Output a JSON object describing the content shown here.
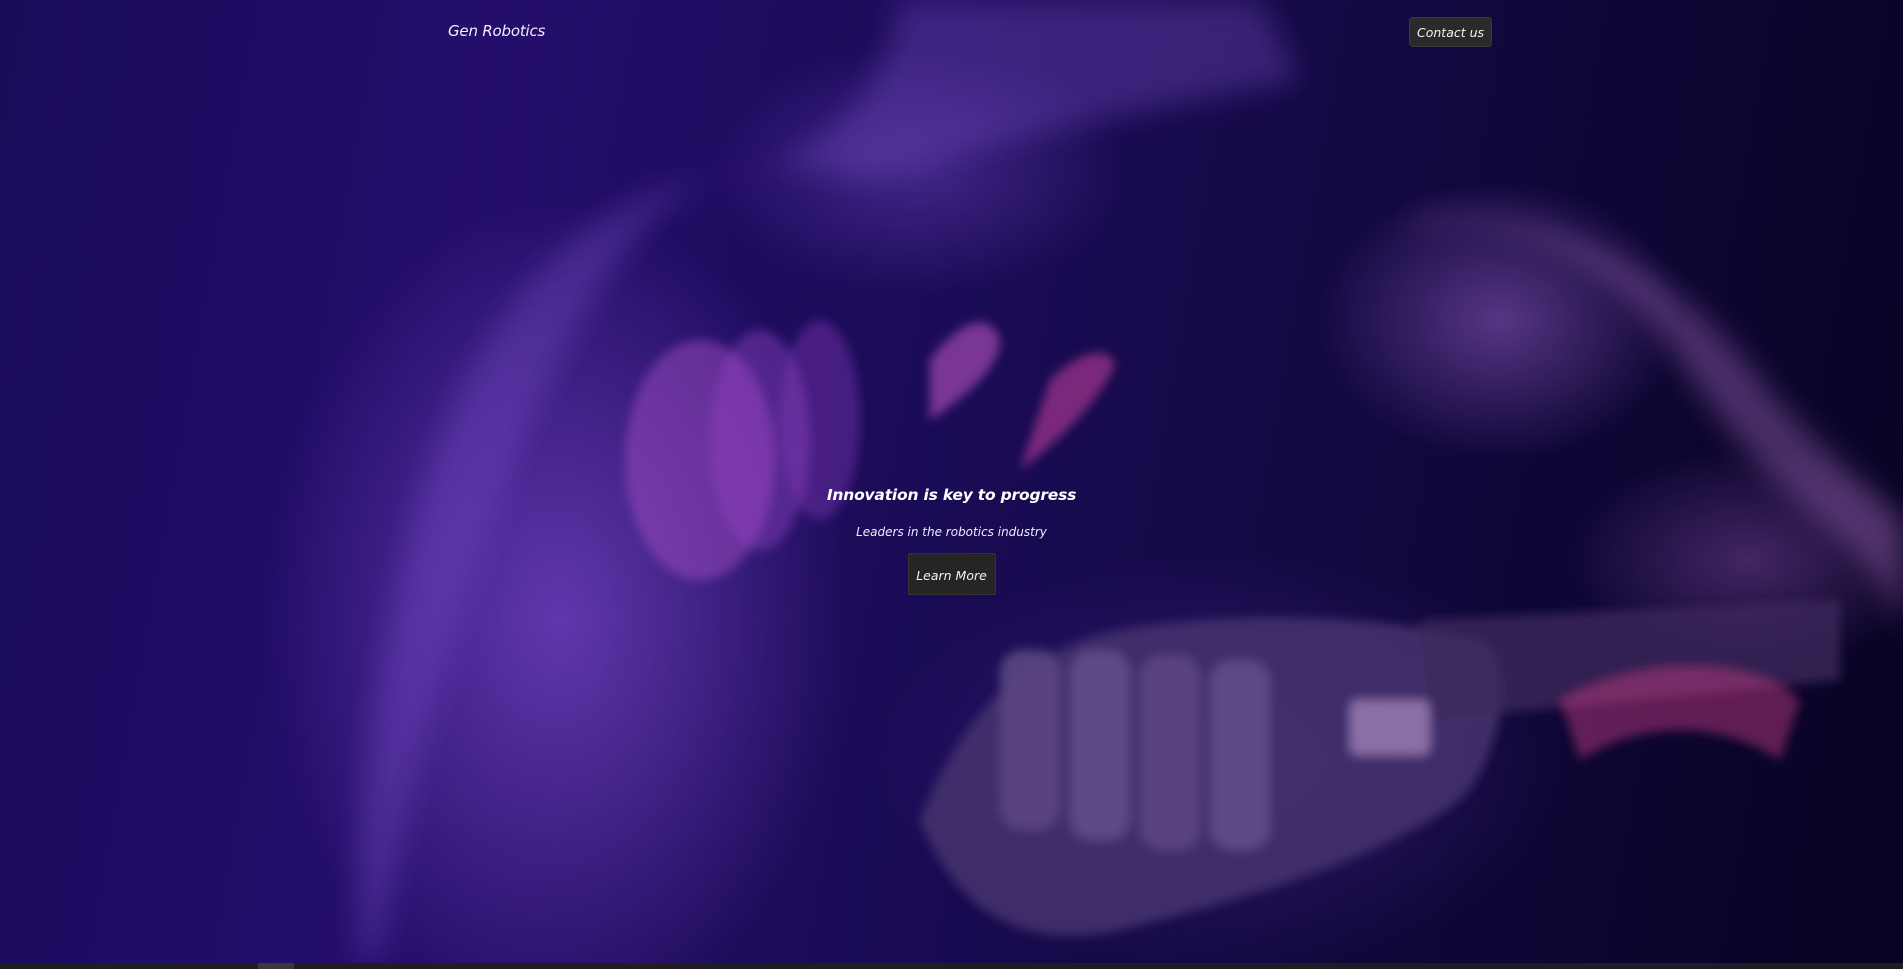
{
  "navbar": {
    "brand": "Gen Robotics",
    "contact_label": "Contact us"
  },
  "hero": {
    "headline": "Innovation is key to progress",
    "subtitle": "Leaders in the robotics industry",
    "cta_label": "Learn More",
    "background": "photo-human-hand-pointing-and-robotic-hand"
  },
  "colors": {
    "overlay": "#1a0b5a",
    "button_bg": "#252525",
    "text": "#ffffff"
  }
}
